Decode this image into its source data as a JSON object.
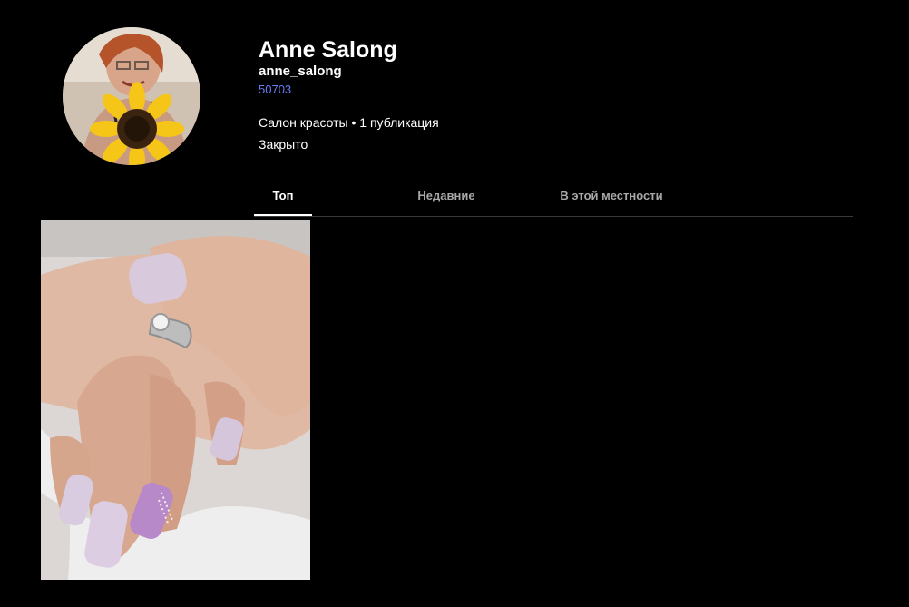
{
  "profile": {
    "display_name": "Anne Salong",
    "username": "anne_salong",
    "post_count_label": "50703",
    "category_line": "Салон красоты • 1 публикация",
    "status": "Закрыто",
    "avatar_icon": "profile-photo-sunflower"
  },
  "tabs": [
    {
      "label": "Топ",
      "active": true
    },
    {
      "label": "Недавние",
      "active": false
    },
    {
      "label": "В этой местности",
      "active": false
    }
  ],
  "posts": [
    {
      "icon": "manicure-photo"
    }
  ],
  "colors": {
    "background": "#000000",
    "link": "#6b7bf0",
    "inactive_tab": "#a8a8a8",
    "divider": "#3a3a3a"
  }
}
